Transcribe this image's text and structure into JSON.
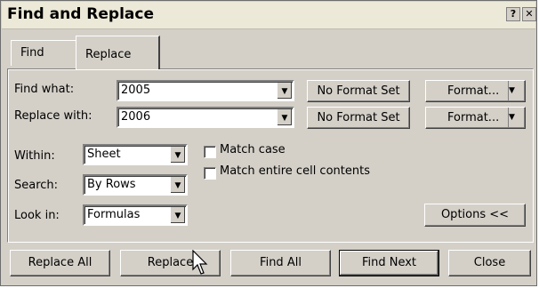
{
  "title": "Find and Replace",
  "titlebar_icons": [
    "help-icon",
    "close-icon"
  ],
  "tabs": {
    "find": "Find",
    "replace": "Replace"
  },
  "find": {
    "label": "Find what:",
    "value": "2005",
    "format_status": "No Format Set",
    "format_button": "Format..."
  },
  "replace": {
    "label": "Replace with:",
    "value": "2006",
    "format_status": "No Format Set",
    "format_button": "Format..."
  },
  "options": {
    "within_label": "Within:",
    "within_value": "Sheet",
    "search_label": "Search:",
    "search_value": "By Rows",
    "lookin_label": "Look in:",
    "lookin_value": "Formulas",
    "match_case": "Match case",
    "match_entire": "Match entire cell contents",
    "options_button": "Options <<"
  },
  "buttons": {
    "replace_all": "Replace All",
    "replace": "Replace",
    "find_all": "Find All",
    "find_next": "Find Next",
    "close": "Close"
  }
}
